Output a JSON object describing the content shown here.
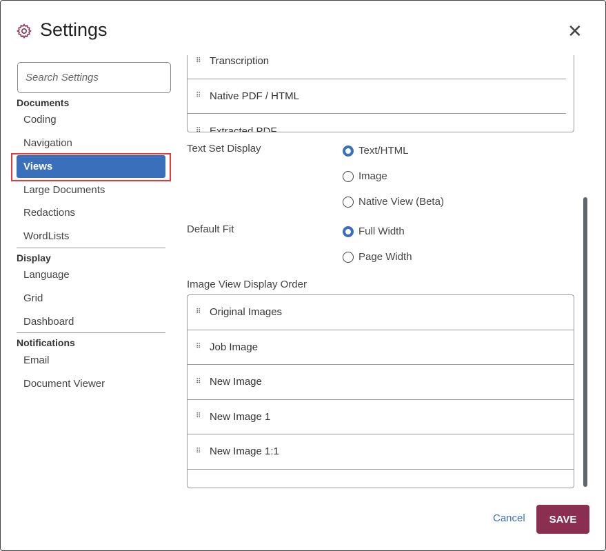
{
  "dialog": {
    "title": "Settings",
    "close_icon": "close-icon",
    "gear_icon": "gear-icon"
  },
  "sidebar": {
    "search_placeholder": "Search Settings",
    "groups": [
      {
        "label": "Documents",
        "items": [
          "Coding",
          "Navigation",
          "Views",
          "Large Documents",
          "Redactions",
          "WordLists"
        ]
      },
      {
        "label": "Display",
        "items": [
          "Language",
          "Grid",
          "Dashboard"
        ]
      },
      {
        "label": "Notifications",
        "items": [
          "Email",
          "Document Viewer"
        ]
      }
    ],
    "active": "Views"
  },
  "main": {
    "text_view_order": [
      "Transcription",
      "Native PDF / HTML",
      "Extracted PDF"
    ],
    "text_set_display": {
      "label": "Text Set Display",
      "options": [
        "Text/HTML",
        "Image",
        "Native View (Beta)"
      ],
      "selected": "Text/HTML"
    },
    "default_fit": {
      "label": "Default Fit",
      "options": [
        "Full Width",
        "Page Width"
      ],
      "selected": "Full Width"
    },
    "image_view": {
      "label": "Image View Display Order",
      "items": [
        "Original Images",
        "Job Image",
        "New Image",
        "New Image 1",
        "New Image 1:1"
      ]
    }
  },
  "footer": {
    "cancel": "Cancel",
    "save": "SAVE"
  },
  "colors": {
    "accent": "#3a6fbb",
    "save": "#8b2f50",
    "highlight_outline": "#e8383d"
  }
}
